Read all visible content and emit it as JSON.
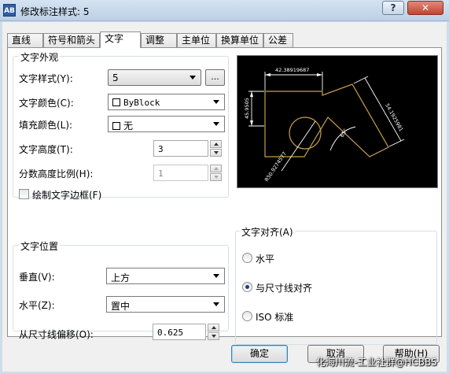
{
  "window": {
    "title": "修改标注样式: 5",
    "icon_label": "AB",
    "help_button": "?",
    "close_button": "✕"
  },
  "tabs": [
    "直线",
    "符号和箭头",
    "文字",
    "调整",
    "主单位",
    "换算单位",
    "公差"
  ],
  "active_tab": "文字",
  "text_appearance": {
    "title": "文字外观",
    "text_style_label": "文字样式(Y):",
    "text_style_value": "5",
    "browse_button": "...",
    "text_color_label": "文字颜色(C):",
    "text_color_value": "ByBlock",
    "fill_color_label": "填充颜色(L):",
    "fill_color_value": "无",
    "text_height_label": "文字高度(T):",
    "text_height_value": "3",
    "fraction_scale_label": "分数高度比例(H):",
    "fraction_scale_value": "1",
    "draw_frame_label": "绘制文字边框(F)"
  },
  "preview": {
    "dim_top": "42.38919687",
    "dim_left": "45.9505",
    "dim_right": "54.1925981",
    "dim_bottom": "R50.9274577",
    "dim_angle": "65°",
    "colors": {
      "bg": "#000000",
      "geometry": "#c8a04a",
      "dims": "#ffffff"
    }
  },
  "text_placement": {
    "title": "文字位置",
    "vertical_label": "垂直(V):",
    "vertical_value": "上方",
    "horizontal_label": "水平(Z):",
    "horizontal_value": "置中",
    "offset_label": "从尺寸线偏移(O):",
    "offset_value": "0.625"
  },
  "text_alignment": {
    "title": "文字对齐(A)",
    "options": [
      "水平",
      "与尺寸线对齐",
      "ISO 标准"
    ],
    "selected": "与尺寸线对齐"
  },
  "buttons": {
    "ok": "确定",
    "cancel": "取消",
    "help": "帮助(H)"
  },
  "watermark": "化海川流-工业社群@HCBBS"
}
